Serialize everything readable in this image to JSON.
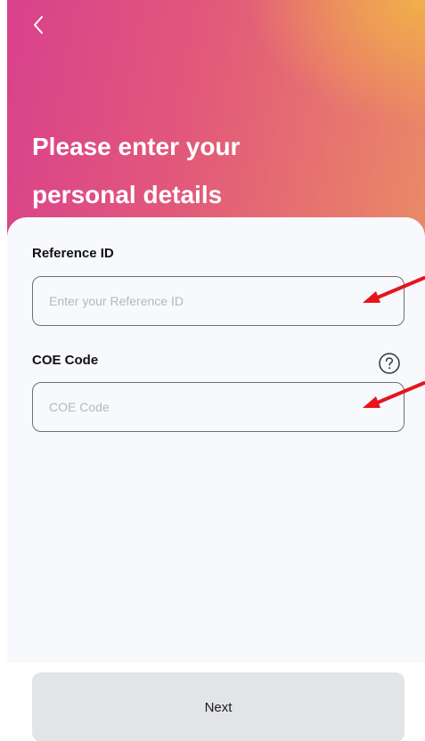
{
  "header": {
    "title": "Please enter your\npersonal details"
  },
  "form": {
    "reference_id": {
      "label": "Reference ID",
      "placeholder": "Enter your Reference ID",
      "value": ""
    },
    "coe_code": {
      "label": "COE Code",
      "placeholder": "COE Code",
      "value": ""
    }
  },
  "footer": {
    "next_label": "Next"
  },
  "icons": {
    "back": "chevron-left-icon",
    "help": "question-circle-icon",
    "annotation": "red-arrow-icon"
  },
  "colors": {
    "gradient_start": "#d9418c",
    "gradient_end": "#f2b248",
    "annotation_arrow": "#e8141c",
    "button_bg": "#e3e4e7"
  }
}
